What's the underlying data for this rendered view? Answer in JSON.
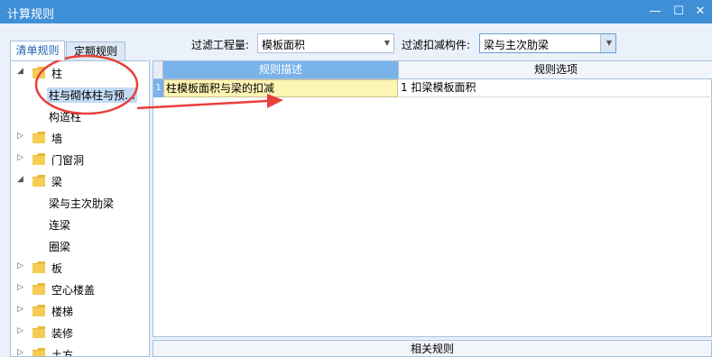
{
  "window": {
    "title": "计算规则",
    "minimize_glyph": "—",
    "maximize_glyph": "☐",
    "close_glyph": "✕"
  },
  "tabs": [
    {
      "label": "清单规则",
      "active": true
    },
    {
      "label": "定额规则",
      "active": false
    }
  ],
  "filters": {
    "quantity_label": "过滤工程量:",
    "quantity_value": "模板面积",
    "component_label": "过滤扣减构件:",
    "component_value": "梁与主次肋梁"
  },
  "tree": {
    "items": [
      {
        "label": "柱",
        "expanded": true,
        "level": 0
      },
      {
        "label": "柱与砌体柱与预…",
        "level": 1,
        "selected": true
      },
      {
        "label": "构造柱",
        "level": 1
      },
      {
        "label": "墙",
        "expanded": false,
        "level": 0
      },
      {
        "label": "门窗洞",
        "expanded": false,
        "level": 0
      },
      {
        "label": "梁",
        "expanded": true,
        "level": 0
      },
      {
        "label": "梁与主次肋梁",
        "level": 1
      },
      {
        "label": "连梁",
        "level": 1
      },
      {
        "label": "圈梁",
        "level": 1
      },
      {
        "label": "板",
        "expanded": false,
        "level": 0
      },
      {
        "label": "空心楼盖",
        "expanded": false,
        "level": 0
      },
      {
        "label": "楼梯",
        "expanded": false,
        "level": 0
      },
      {
        "label": "装修",
        "expanded": false,
        "level": 0
      },
      {
        "label": "土方",
        "expanded": false,
        "level": 0
      }
    ]
  },
  "grid": {
    "columns": [
      "规则描述",
      "规则选项"
    ],
    "rows": [
      {
        "num": "1",
        "description": "柱模板面积与梁的扣减",
        "option": "1  扣梁模板面积"
      }
    ]
  },
  "related_rules": {
    "label": "相关规则"
  },
  "colors": {
    "titlebar": "#3e8fd6",
    "annotation": "#e8403a",
    "header_highlight": "#7ab2ea",
    "cell_highlight": "#fdf5b4"
  }
}
